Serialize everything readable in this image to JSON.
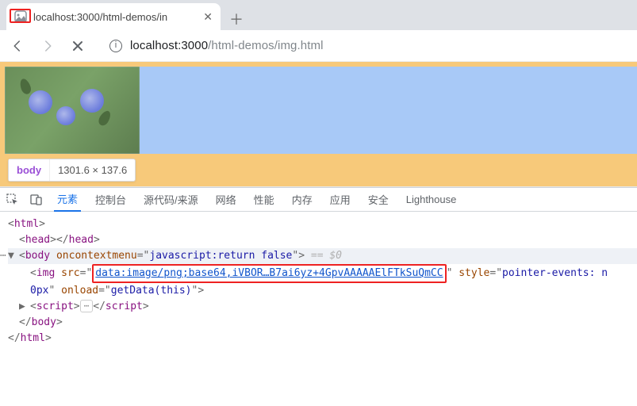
{
  "browser": {
    "tab_title": "localhost:3000/html-demos/in",
    "url_host_port": "localhost:3000",
    "url_path": "/html-demos/img.html"
  },
  "hover": {
    "tag": "body",
    "dimensions": "1301.6 × 137.6"
  },
  "devtools": {
    "tabs": {
      "elements": "元素",
      "console": "控制台",
      "sources": "源代码/来源",
      "network": "网络",
      "performance": "性能",
      "memory": "内存",
      "application": "应用",
      "security": "安全",
      "lighthouse": "Lighthouse"
    }
  },
  "dom": {
    "html_open": "html",
    "head_open": "head",
    "head_close": "head",
    "body": {
      "tag": "body",
      "attr_name": "oncontextmenu",
      "attr_value": "javascript:return false",
      "selected_marker": "== $0"
    },
    "img": {
      "tag": "img",
      "src_name": "src",
      "src_value": "data:image/png;base64,iVBOR…B7ai6yz+4GpvAAAAAElFTkSuQmCC",
      "style_name": "style",
      "style_value_partial": "pointer-events: n",
      "cont_value": "0px",
      "onload_name": "onload",
      "onload_value": "getData(this)"
    },
    "script_tag": "script",
    "body_close": "body",
    "html_close": "html",
    "ellipsis": "⋯"
  }
}
